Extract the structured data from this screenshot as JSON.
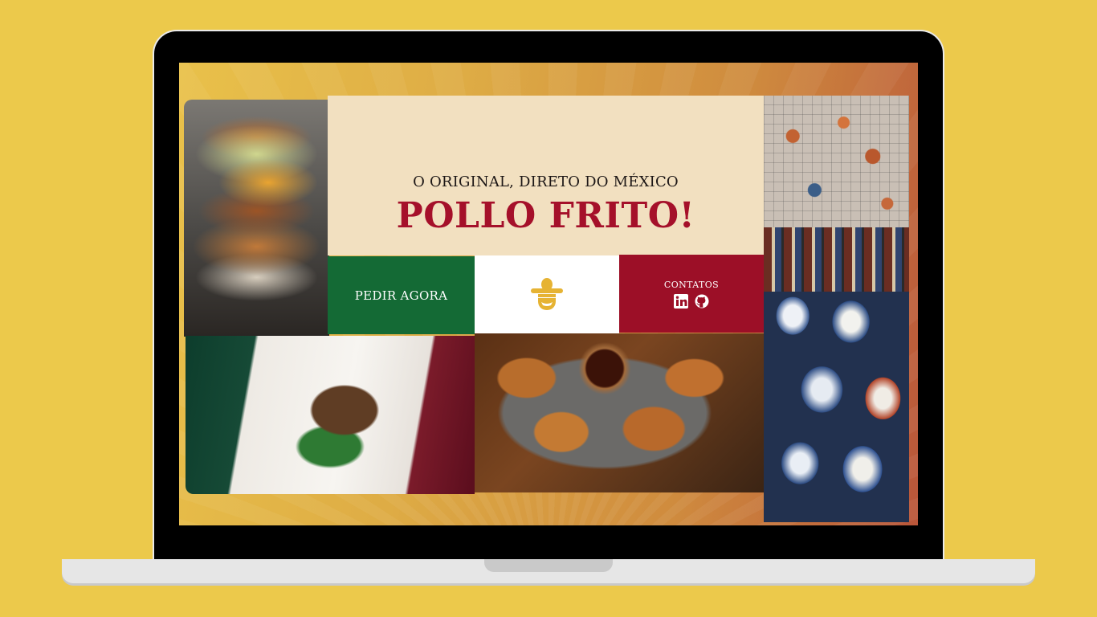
{
  "hero": {
    "tagline": "O ORIGINAL, DIRETO DO MÉXICO",
    "headline": "POLLO FRITO!"
  },
  "actions": {
    "order_label": "PEDIR AGORA"
  },
  "contacts": {
    "label": "CONTATOS",
    "links": [
      {
        "icon": "linkedin-icon"
      },
      {
        "icon": "github-icon"
      }
    ]
  },
  "logo": {
    "icon": "sombrero-face-icon"
  },
  "images": [
    {
      "name": "fried-chicken-burger-photo"
    },
    {
      "name": "mexican-tiles-and-pottery-photo"
    },
    {
      "name": "mexican-flag-photo"
    },
    {
      "name": "fried-chicken-basket-photo"
    }
  ],
  "colors": {
    "background": "#ecc94b",
    "brand_green": "#146a35",
    "brand_red": "#a5102a",
    "hero_cream": "#f2e0c0"
  }
}
